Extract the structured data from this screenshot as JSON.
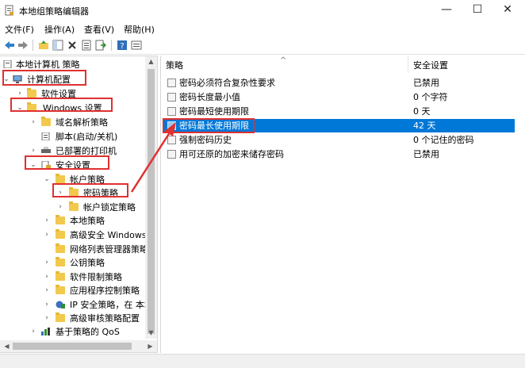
{
  "window": {
    "title": "本地组策略编辑器",
    "minimize": "—",
    "maximize": "☐",
    "close": "✕"
  },
  "menu": [
    "文件(F)",
    "操作(A)",
    "查看(V)",
    "帮助(H)"
  ],
  "tree": {
    "root": "本地计算机 策略",
    "computer_config": "计算机配置",
    "software_settings": "软件设置",
    "windows_settings": "Windows 设置",
    "dns_policy": "域名解析策略",
    "scripts": "脚本(启动/关机)",
    "printers": "已部署的打印机",
    "security_settings": "安全设置",
    "account_policies": "帐户策略",
    "password_policy": "密码策略",
    "lockout_policy": "帐户锁定策略",
    "local_policies": "本地策略",
    "firewall": "高级安全 Windows",
    "network_list": "网络列表管理器策略",
    "public_key": "公钥策略",
    "software_restriction": "软件限制策略",
    "app_control": "应用程序控制策略",
    "ipsec": "IP 安全策略，在 本地",
    "audit": "高级审核策略配置",
    "qos": "基于策略的 QoS"
  },
  "list": {
    "col_policy": "策略",
    "col_setting": "安全设置",
    "rows": [
      {
        "name": "密码必须符合复杂性要求",
        "value": "已禁用"
      },
      {
        "name": "密码长度最小值",
        "value": "0 个字符"
      },
      {
        "name": "密码最短使用期限",
        "value": "0 天"
      },
      {
        "name": "密码最长使用期限",
        "value": "42 天"
      },
      {
        "name": "强制密码历史",
        "value": "0 个记住的密码"
      },
      {
        "name": "用可还原的加密来储存密码",
        "value": "已禁用"
      }
    ]
  },
  "colors": {
    "selection": "#0078d7",
    "annotation_red": "#e03030",
    "folder": "#f2c94c"
  }
}
